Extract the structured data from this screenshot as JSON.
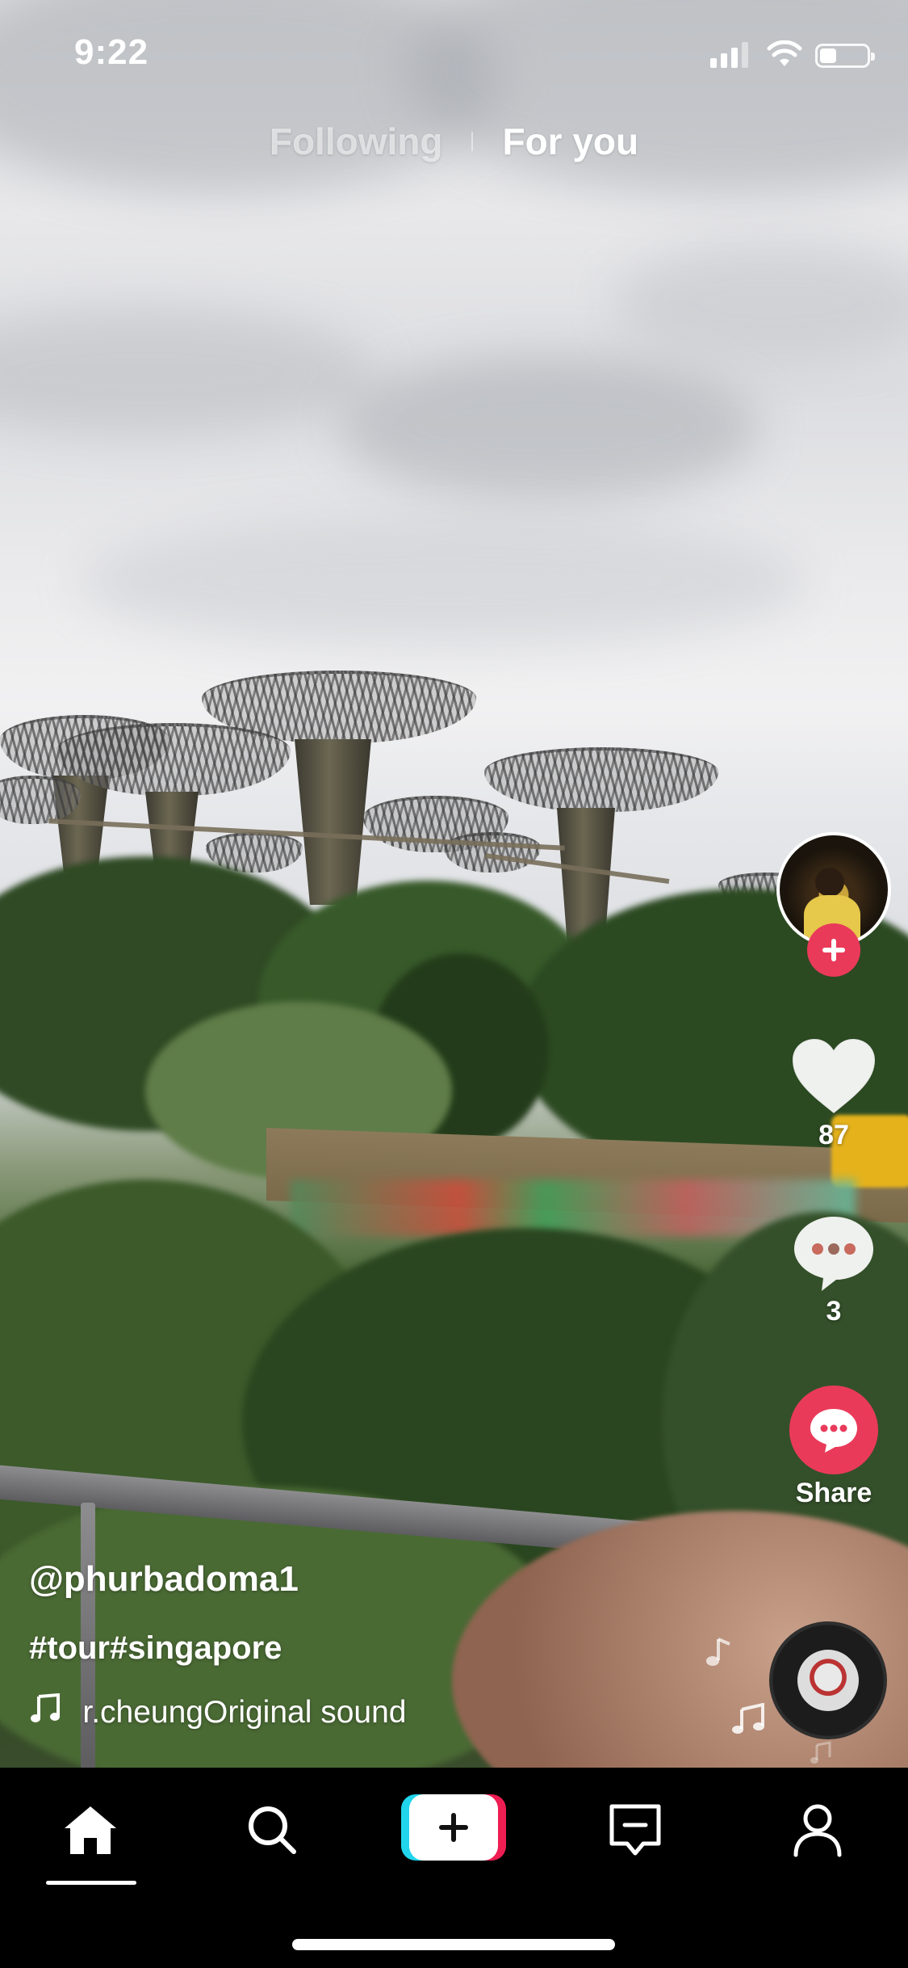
{
  "status_bar": {
    "time": "9:22",
    "battery_level": 0.35,
    "signal_bars": 3
  },
  "top_tabs": [
    {
      "label": "Following",
      "active": false
    },
    {
      "label": "For you",
      "active": true
    }
  ],
  "actions": {
    "like_count": "87",
    "comment_count": "3",
    "share_label": "Share"
  },
  "caption": {
    "username": "@phurbadoma1",
    "hashtags": "#tour#singapore",
    "sound_creator": "r.cheung",
    "sound_title": "Original sound"
  },
  "nav": {
    "items": [
      "home-icon",
      "search-icon",
      "create-icon",
      "inbox-icon",
      "profile-icon"
    ],
    "active": "home"
  },
  "colors": {
    "accent": "#EA3A5A",
    "create_left": "#20D5EC",
    "create_right": "#EE1D52"
  }
}
